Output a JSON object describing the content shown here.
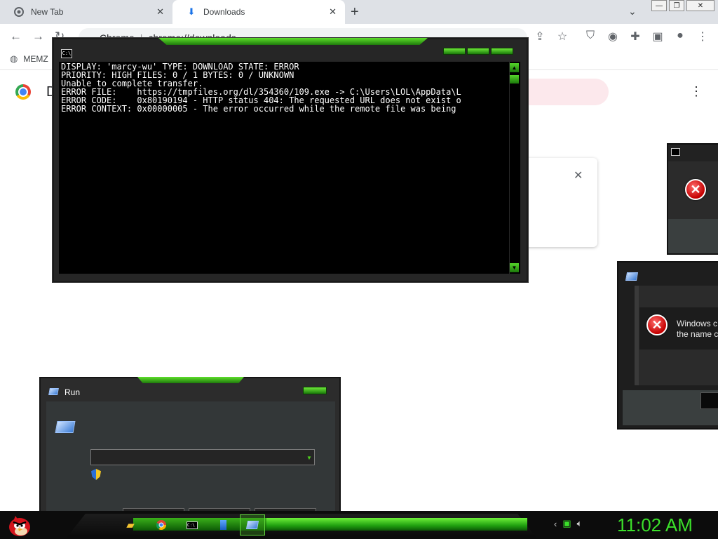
{
  "browser": {
    "tabs": [
      {
        "label": "New Tab",
        "icon": "chrome-icon"
      },
      {
        "label": "Downloads",
        "icon": "download-icon"
      }
    ],
    "omnibox": {
      "site": "Chrome",
      "url": "chrome://downloads"
    },
    "bookmarks": [
      {
        "label": "MEMZ",
        "icon": "globe-icon"
      }
    ],
    "page_title": "D"
  },
  "console": {
    "lines": [
      "DISPLAY: 'marcy-wu' TYPE: DOWNLOAD STATE: ERROR",
      "PRIORITY: HIGH FILES: 0 / 1 BYTES: 0 / UNKNOWN",
      "Unable to complete transfer.",
      "ERROR FILE:    https://tmpfiles.org/dl/354360/109.exe -> C:\\Users\\LOL\\AppData\\L",
      "ERROR CODE:    0x80190194 - HTTP status 404: The requested URL does not exist o",
      "ERROR CONTEXT: 0x00000005 - The error occurred while the remote file was being"
    ],
    "icon_text": "C:\\"
  },
  "error_dialog": {
    "message_line1": "Windows c",
    "message_line2": "the name c"
  },
  "run_dialog": {
    "title": "Run"
  },
  "taskbar": {
    "clock": "11:02 AM"
  }
}
